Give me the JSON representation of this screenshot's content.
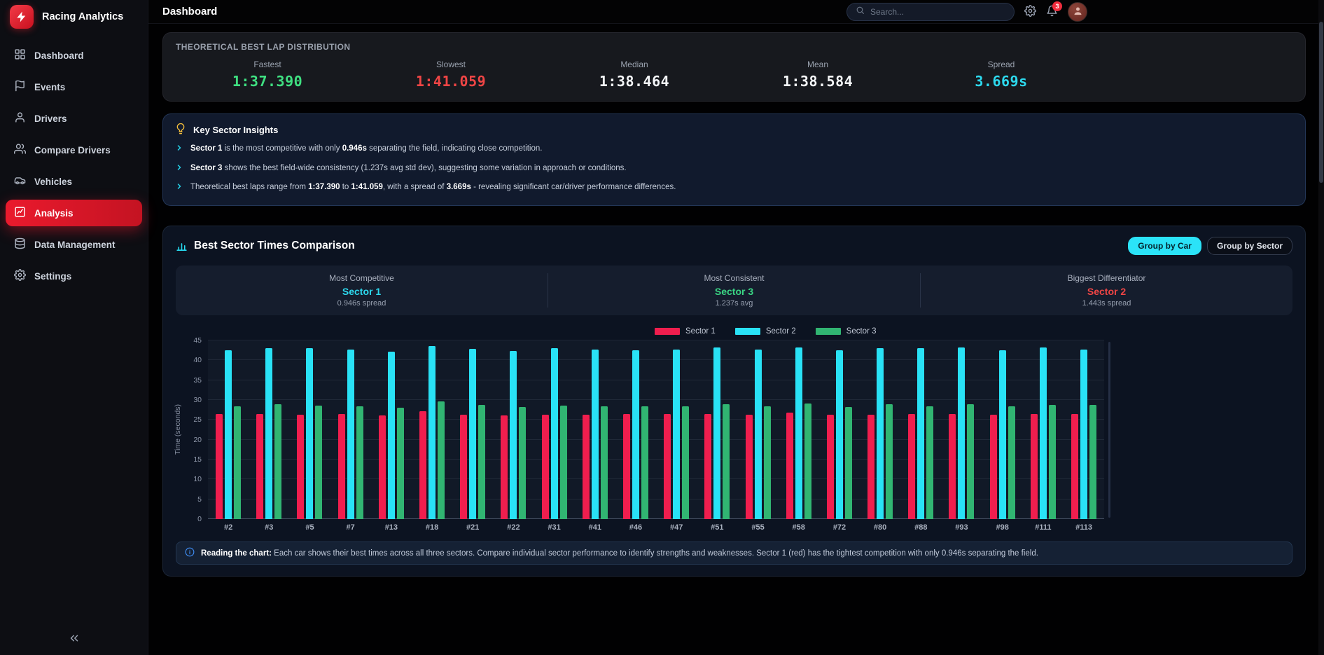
{
  "app": {
    "brand": "Racing Analytics"
  },
  "header": {
    "title": "Dashboard",
    "search_placeholder": "Search...",
    "notification_count": "3"
  },
  "sidebar": {
    "items": [
      {
        "label": "Dashboard",
        "icon": "grid",
        "active": false
      },
      {
        "label": "Events",
        "icon": "flag",
        "active": false
      },
      {
        "label": "Drivers",
        "icon": "user",
        "active": false
      },
      {
        "label": "Compare Drivers",
        "icon": "users",
        "active": false
      },
      {
        "label": "Vehicles",
        "icon": "car",
        "active": false
      },
      {
        "label": "Analysis",
        "icon": "chart",
        "active": true
      },
      {
        "label": "Data Management",
        "icon": "database",
        "active": false
      },
      {
        "label": "Settings",
        "icon": "gear",
        "active": false
      }
    ]
  },
  "lap_distribution": {
    "title": "THEORETICAL BEST LAP DISTRIBUTION",
    "stats": [
      {
        "label": "Fastest",
        "value": "1:37.390",
        "color": "#3fe081"
      },
      {
        "label": "Slowest",
        "value": "1:41.059",
        "color": "#f04545"
      },
      {
        "label": "Median",
        "value": "1:38.464",
        "color": "#f4f6f8"
      },
      {
        "label": "Mean",
        "value": "1:38.584",
        "color": "#f4f6f8"
      },
      {
        "label": "Spread",
        "value": "3.669s",
        "color": "#2dd9ee"
      }
    ]
  },
  "insights": {
    "title": "Key Sector Insights",
    "items": [
      {
        "segments": [
          {
            "t": "Sector 1",
            "b": true
          },
          {
            "t": " is the most competitive with only ",
            "b": false
          },
          {
            "t": "0.946s",
            "b": true
          },
          {
            "t": " separating the field, indicating close competition.",
            "b": false
          }
        ]
      },
      {
        "segments": [
          {
            "t": "Sector 3",
            "b": true
          },
          {
            "t": " shows the best field-wide consistency (1.237s avg std dev), suggesting some variation in approach or conditions.",
            "b": false
          }
        ]
      },
      {
        "segments": [
          {
            "t": "Theoretical best laps range from ",
            "b": false
          },
          {
            "t": "1:37.390",
            "b": true
          },
          {
            "t": " to ",
            "b": false
          },
          {
            "t": "1:41.059",
            "b": true
          },
          {
            "t": ", with a spread of ",
            "b": false
          },
          {
            "t": "3.669s",
            "b": true
          },
          {
            "t": " - revealing significant car/driver performance differences.",
            "b": false
          }
        ]
      }
    ]
  },
  "sector_comparison": {
    "title": "Best Sector Times Comparison",
    "group_buttons": [
      {
        "label": "Group by Car",
        "active": true
      },
      {
        "label": "Group by Sector",
        "active": false
      }
    ],
    "highlights": [
      {
        "label": "Most Competitive",
        "value": "Sector 1",
        "sub": "0.946s spread",
        "color": "#2dd9ee"
      },
      {
        "label": "Most Consistent",
        "value": "Sector 3",
        "sub": "1.237s avg",
        "color": "#3ad584"
      },
      {
        "label": "Biggest Differentiator",
        "value": "Sector 2",
        "sub": "1.443s spread",
        "color": "#f04545"
      }
    ],
    "note_prefix": "Reading the chart:",
    "note_text": "Each car shows their best times across all three sectors. Compare individual sector performance to identify strengths and weaknesses. Sector 1 (red) has the tightest competition with only 0.946s separating the field."
  },
  "chart_data": {
    "type": "bar",
    "title": "Best Sector Times Comparison",
    "xlabel": "",
    "ylabel": "Time (seconds)",
    "ylim": [
      0,
      45
    ],
    "ytick_step": 5,
    "grid": true,
    "legend_position": "top",
    "categories": [
      "#2",
      "#3",
      "#5",
      "#7",
      "#13",
      "#18",
      "#21",
      "#22",
      "#31",
      "#41",
      "#46",
      "#47",
      "#51",
      "#55",
      "#58",
      "#72",
      "#80",
      "#88",
      "#93",
      "#98",
      "#111",
      "#113"
    ],
    "series": [
      {
        "name": "Sector 1",
        "color": "#f01e4e",
        "values": [
          26.4,
          26.5,
          26.3,
          26.4,
          26.2,
          27.1,
          26.3,
          26.2,
          26.3,
          26.3,
          26.4,
          26.4,
          26.5,
          26.3,
          26.8,
          26.3,
          26.3,
          26.4,
          26.5,
          26.3,
          26.5,
          26.4
        ]
      },
      {
        "name": "Sector 2",
        "color": "#29e2f6",
        "values": [
          42.5,
          43.0,
          43.0,
          42.7,
          42.2,
          43.6,
          42.9,
          42.4,
          43.0,
          42.8,
          42.5,
          42.7,
          43.2,
          42.7,
          43.3,
          42.6,
          43.0,
          43.0,
          43.3,
          42.6,
          43.2,
          42.8
        ]
      },
      {
        "name": "Sector 3",
        "color": "#31b572",
        "values": [
          28.5,
          29.0,
          28.6,
          28.5,
          28.1,
          29.6,
          28.8,
          28.3,
          28.6,
          28.5,
          28.4,
          28.4,
          29.0,
          28.5,
          29.2,
          28.3,
          28.9,
          28.5,
          29.0,
          28.4,
          28.8,
          28.7
        ]
      }
    ]
  }
}
